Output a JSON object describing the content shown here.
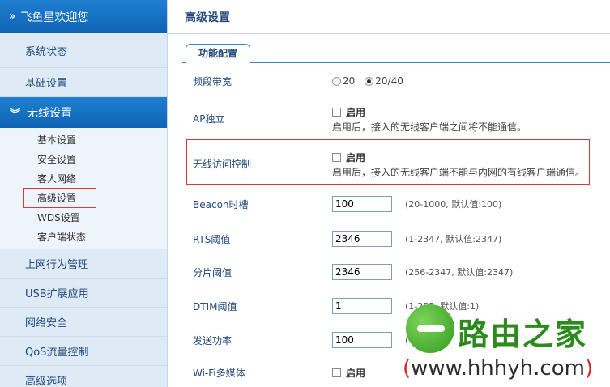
{
  "sidebar": {
    "header": "飞鱼星欢迎您",
    "top_items": [
      "系统状态",
      "基础设置"
    ],
    "section": "无线设置",
    "sub_items": [
      "基本设置",
      "安全设置",
      "客人网络",
      "高级设置",
      "WDS设置",
      "客户端状态"
    ],
    "bottom_items": [
      "上网行为管理",
      "USB扩展应用",
      "网络安全",
      "QoS流量控制",
      "高级选项"
    ]
  },
  "main": {
    "title": "高级设置",
    "tab": "功能配置",
    "bandwidth": {
      "label": "频段带宽",
      "opt1": "20",
      "opt2": "20/40"
    },
    "ap_isolation": {
      "label": "AP独立",
      "check": "启用",
      "desc": "启用后，接入的无线客户端之间将不能通信。"
    },
    "access_control": {
      "label": "无线访问控制",
      "check": "启用",
      "desc": "启用后，接入的无线客户端不能与内网的有线客户端通信。"
    },
    "beacon": {
      "label": "Beacon时槽",
      "value": "100",
      "hint": "(20-1000, 默认值:100)"
    },
    "rts": {
      "label": "RTS阈值",
      "value": "2346",
      "hint": "(1-2347, 默认值:2347)"
    },
    "frag": {
      "label": "分片阈值",
      "value": "2346",
      "hint": "(256-2347, 默认值:2347)"
    },
    "dtim": {
      "label": "DTIM阈值",
      "value": "1",
      "hint": "(1-255, 默认值:1)"
    },
    "txpower": {
      "label": "发送功率",
      "value": "100",
      "hint": "("
    },
    "wmm": {
      "label": "Wi-Fi多媒体",
      "check": "启用"
    }
  },
  "watermark": {
    "cn": "路由之家",
    "url": "www.hhhyh.com"
  }
}
